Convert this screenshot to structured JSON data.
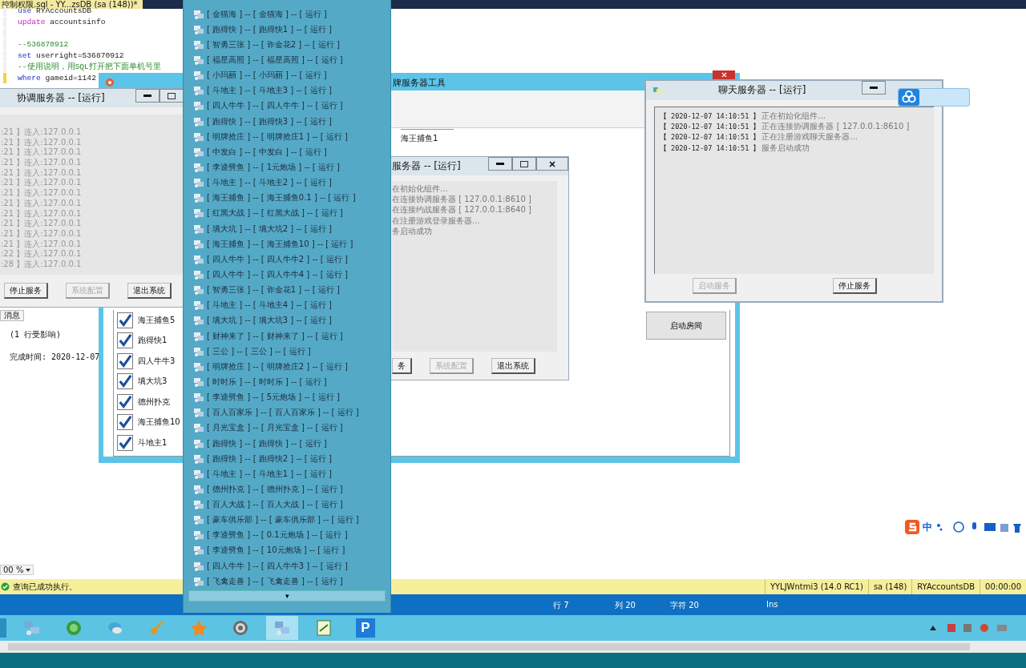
{
  "editor": {
    "tab_title": "控制权限.sql - YY...zsDB (sa (148))*",
    "code": [
      {
        "kind": "code",
        "marked": false,
        "parts": [
          {
            "kind": "kw",
            "text": "use"
          },
          {
            "kind": "plain",
            "text": " RYAccountsDB"
          }
        ]
      },
      {
        "kind": "code",
        "marked": false,
        "parts": [
          {
            "kind": "dml",
            "text": "update"
          },
          {
            "kind": "plain",
            "text": " accountsinfo"
          }
        ]
      },
      {
        "kind": "blank",
        "marked": false
      },
      {
        "kind": "code",
        "marked": false,
        "parts": [
          {
            "kind": "comment",
            "text": "--536870912"
          }
        ]
      },
      {
        "kind": "code",
        "marked": false,
        "parts": [
          {
            "kind": "kw",
            "text": "set"
          },
          {
            "kind": "plain",
            "text": " userright=536870912"
          }
        ]
      },
      {
        "kind": "code",
        "marked": false,
        "parts": [
          {
            "kind": "comment",
            "text": "--使用说明，用SQL打开把下面单机号里"
          }
        ]
      },
      {
        "kind": "code",
        "marked": true,
        "parts": [
          {
            "kind": "kw",
            "text": "where"
          },
          {
            "kind": "plain",
            "text": " gameid=1142"
          }
        ]
      }
    ],
    "results_tab": "消息",
    "results": [
      "(1 行受影响)",
      "完成时间: 2020-12-07"
    ],
    "zoom": "00 %"
  },
  "status_bar": {
    "message": "查询已成功执行。",
    "cells": [
      "YYLJWntmi3 (14.0 RC1)",
      "sa (148)",
      "RYAccountsDB",
      "00:00:00"
    ]
  },
  "position_bar": [
    "行 7",
    "列 20",
    "字符 20",
    "Ins"
  ],
  "tool_window": {
    "title": "牌服务器工具",
    "top_item": "海王捕鱼1",
    "rooms": [
      {
        "label": "海王捕鱼5",
        "checked": true
      },
      {
        "label": "跑得快1",
        "checked": true
      },
      {
        "label": "四人牛牛3",
        "checked": true
      },
      {
        "label": "填大坑3",
        "checked": true
      },
      {
        "label": "德州扑克",
        "checked": true
      },
      {
        "label": "海王捕鱼10",
        "checked": true
      },
      {
        "label": "斗地主1",
        "checked": true
      }
    ],
    "start_room_button": "启动房间"
  },
  "coord_window": {
    "title": "协调服务器 -- [运行]",
    "log": [
      ":21 】连入:127.0.0.1",
      ":21 】连入:127.0.0.1",
      ":21 】连入:127.0.0.1",
      ":21 】连入:127.0.0.1",
      ":21 】连入:127.0.0.1",
      ":21 】连入:127.0.0.1",
      ":21 】连入:127.0.0.1",
      ":21 】连入:127.0.0.1",
      ":21 】连入:127.0.0.1",
      ":21 】连入:127.0.0.1",
      ":21 】连入:127.0.0.1",
      ":21 】连入:127.0.0.1",
      ":22 】连入:127.0.0.1",
      ":28 】连入:127.0.0.1"
    ],
    "buttons": [
      {
        "label": "停止服务",
        "disabled": false
      },
      {
        "label": "系统配置",
        "disabled": true
      },
      {
        "label": "退出系统",
        "disabled": false
      }
    ]
  },
  "login_window": {
    "title": "服务器 -- [运行]",
    "log": [
      "在初始化组件...",
      "在连接协调服务器 [ 127.0.0.1:8610 ]",
      "在连接约战服务器 [ 127.0.0.1:8640 ]",
      "在注册游戏登录服务器...",
      "务启动成功"
    ],
    "buttons": [
      {
        "label": "务",
        "disabled": false
      },
      {
        "label": "系统配置",
        "disabled": true
      },
      {
        "label": "退出系统",
        "disabled": false
      }
    ]
  },
  "server_list": {
    "items": [
      "[ 金猫海 ] -- [ 金猫海 ] -- [ 运行 ]",
      "[ 跑得快 ] -- [ 跑得快1 ] -- [ 运行 ]",
      "[ 智勇三张 ] -- [ 诈金花2 ] -- [ 运行 ]",
      "[ 福星高照 ] -- [ 福星高照 ] -- [ 运行 ]",
      "[ 小玛丽 ] -- [ 小玛丽 ] -- [ 运行 ]",
      "[ 斗地主 ] -- [ 斗地主3 ] -- [ 运行 ]",
      "[ 四人牛牛 ] -- [ 四人牛牛 ] -- [ 运行 ]",
      "[ 跑得快 ] -- [ 跑得快3 ] -- [ 运行 ]",
      "[ 明牌抢庄 ] -- [ 明牌抢庄1 ] -- [ 运行 ]",
      "[ 中发白 ] -- [ 中发白 ] -- [ 运行 ]",
      "[ 李逵劈鱼 ] -- [ 1元炮场 ] -- [ 运行 ]",
      "[ 斗地主 ] -- [ 斗地主2 ] -- [ 运行 ]",
      "[ 海王捕鱼 ] -- [ 海王捕鱼0.1 ] -- [ 运行 ]",
      "[ 红黑大战 ] -- [ 红黑大战 ] -- [ 运行 ]",
      "[ 填大坑 ] -- [ 填大坑2 ] -- [ 运行 ]",
      "[ 海王捕鱼 ] -- [ 海王捕鱼10 ] -- [ 运行 ]",
      "[ 四人牛牛 ] -- [ 四人牛牛2 ] -- [ 运行 ]",
      "[ 四人牛牛 ] -- [ 四人牛牛4 ] -- [ 运行 ]",
      "[ 智勇三张 ] -- [ 诈金花1 ] -- [ 运行 ]",
      "[ 斗地主 ] -- [ 斗地主4 ] -- [ 运行 ]",
      "[ 填大坑 ] -- [ 填大坑3 ] -- [ 运行 ]",
      "[ 财神来了 ] -- [ 财神来了 ] -- [ 运行 ]",
      "[ 三公 ] -- [ 三公 ] -- [ 运行 ]",
      "[ 明牌抢庄 ] -- [ 明牌抢庄2 ] -- [ 运行 ]",
      "[ 时时乐 ] -- [ 时时乐 ] -- [ 运行 ]",
      "[ 李逵劈鱼 ] -- [ 5元炮场 ] -- [ 运行 ]",
      "[ 百人百家乐 ] -- [ 百人百家乐 ] -- [ 运行 ]",
      "[ 月光宝盒 ] -- [ 月光宝盒 ] -- [ 运行 ]",
      "[ 跑得快 ] -- [ 跑得快 ] -- [ 运行 ]",
      "[ 跑得快 ] -- [ 跑得快2 ] -- [ 运行 ]",
      "[ 斗地主 ] -- [ 斗地主1 ] -- [ 运行 ]",
      "[ 德州扑克 ] -- [ 德州扑克 ] -- [ 运行 ]",
      "[ 百人大战 ] -- [ 百人大战 ] -- [ 运行 ]",
      "[ 豪车俱乐部 ] -- [ 豪车俱乐部 ] -- [ 运行 ]",
      "[ 李逵劈鱼 ] -- [ 0.1元炮场 ] -- [ 运行 ]",
      "[ 李逵劈鱼 ] -- [ 10元炮场 ] -- [ 运行 ]",
      "[ 四人牛牛 ] -- [ 四人牛牛3 ] -- [ 运行 ]",
      "[ 飞禽走兽 ] -- [ 飞禽走兽 ] -- [ 运行 ]"
    ],
    "scroll_arrow": "▾"
  },
  "chat_window": {
    "title": "聊天服务器 -- [运行]",
    "log": [
      {
        "time": "【 2020-12-07 14:10:51 】",
        "text": "正在初始化组件..."
      },
      {
        "time": "【 2020-12-07 14:10:51 】",
        "text": "正在连接协调服务器 [ 127.0.0.1:8610 ]"
      },
      {
        "time": "【 2020-12-07 14:10:51 】",
        "text": "正在注册游戏聊天服务器..."
      },
      {
        "time": "【 2020-12-07 14:10:51 】",
        "text": "服务启动成功"
      }
    ],
    "buttons": [
      {
        "label": "启动服务",
        "disabled": true
      },
      {
        "label": "停止服务",
        "disabled": false
      }
    ]
  },
  "ime_bar": {
    "mode": "中"
  },
  "taskbar": {
    "apps": [
      {
        "kind": "network",
        "selected": false
      },
      {
        "kind": "recycle",
        "selected": false
      },
      {
        "kind": "chat",
        "selected": false
      },
      {
        "kind": "key",
        "selected": false
      },
      {
        "kind": "star",
        "selected": false
      },
      {
        "kind": "gear",
        "selected": false
      },
      {
        "kind": "network",
        "selected": true
      },
      {
        "kind": "notepad",
        "selected": false
      },
      {
        "kind": "letter",
        "label": "P",
        "selected": false
      }
    ]
  }
}
